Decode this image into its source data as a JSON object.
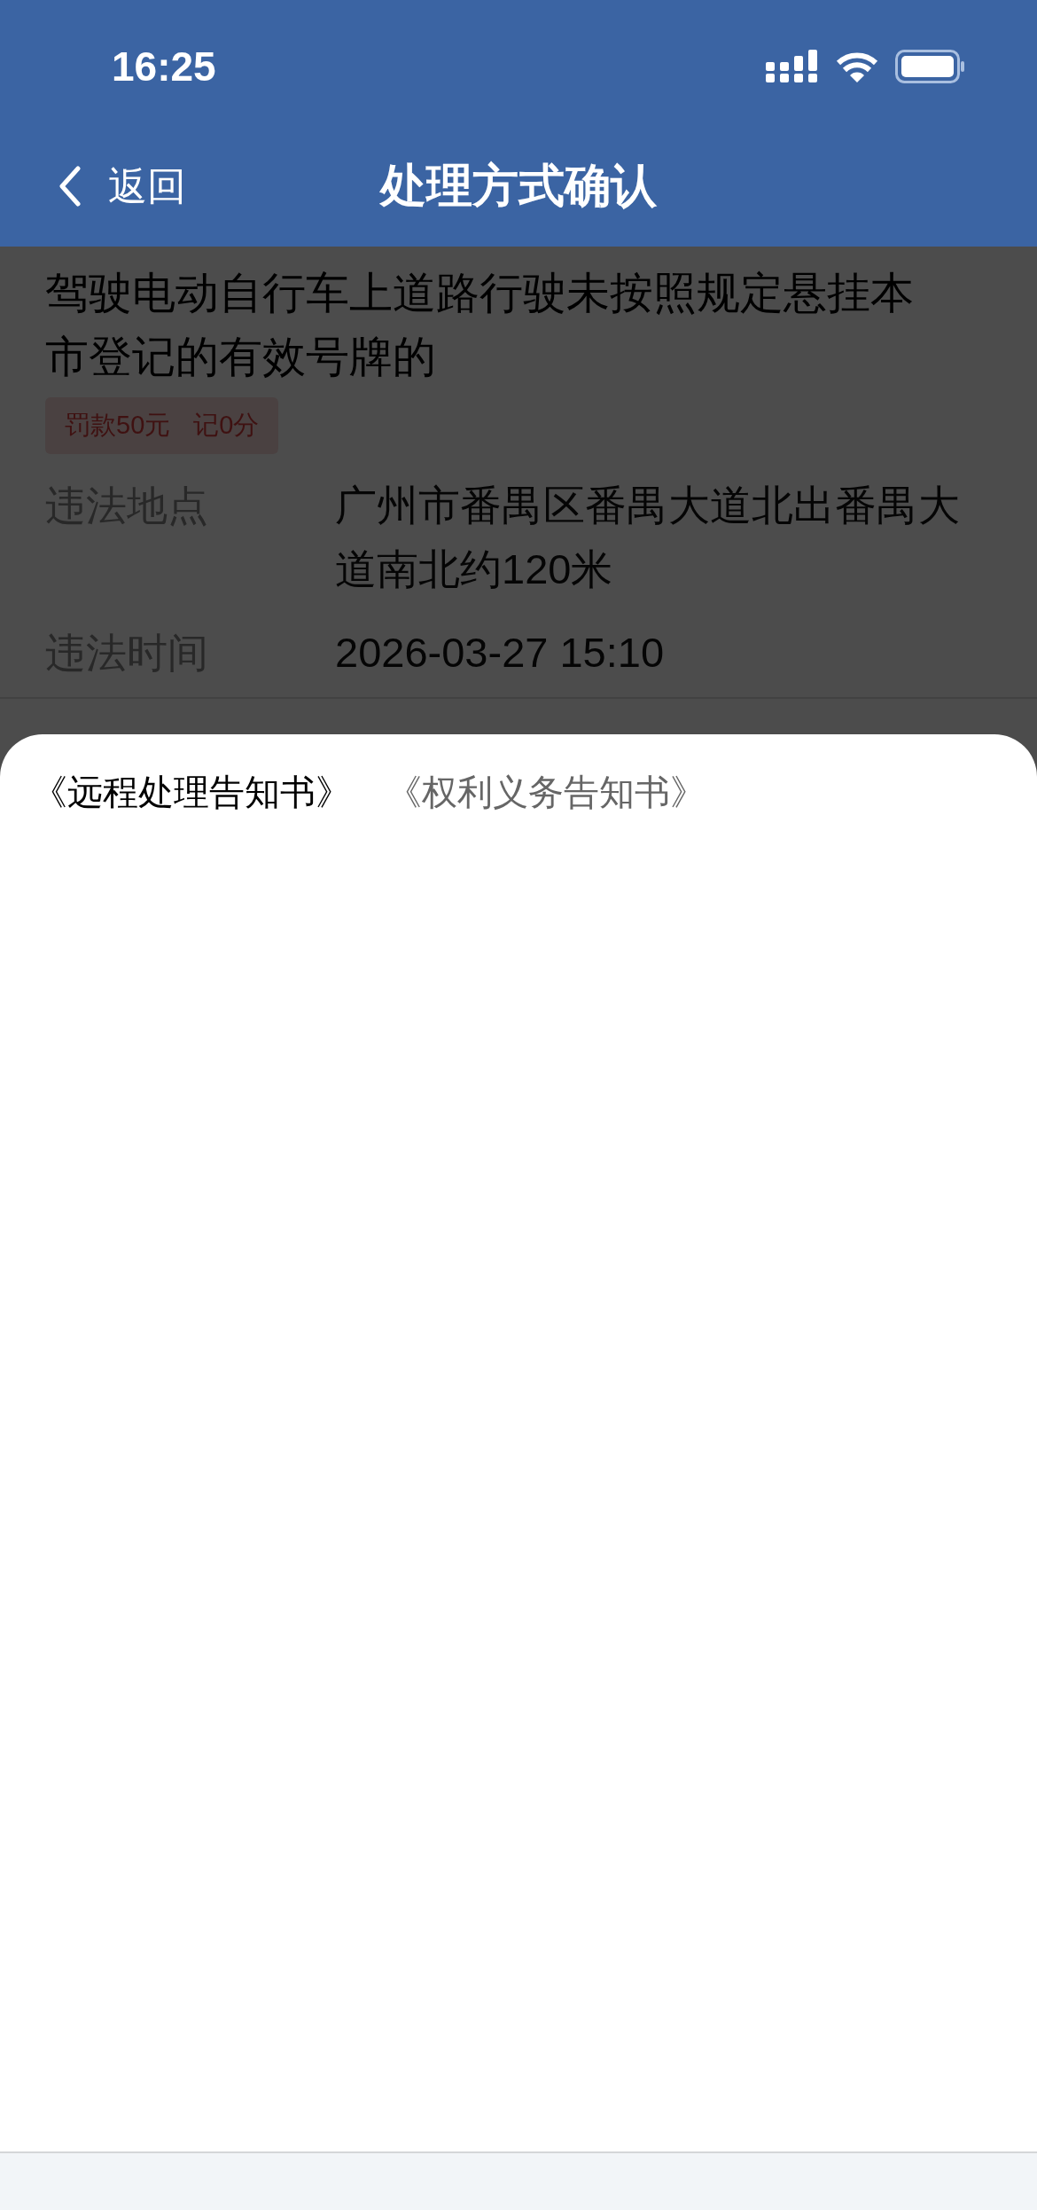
{
  "status_bar": {
    "time": "16:25"
  },
  "nav": {
    "back": "返回",
    "title": "处理方式确认"
  },
  "violation": {
    "title": "驾驶电动自行车上道路行驶未按照规定悬挂本市登记的有效号牌的",
    "tags": [
      "罚款50元",
      "记0分"
    ],
    "fields": [
      {
        "label": "违法地点",
        "value": "广州市番禺区番禺大道北出番禺大道南北约120米"
      },
      {
        "label": "违法时间",
        "value": "2026-03-27 15:10"
      }
    ]
  },
  "sheet": {
    "tabs": [
      {
        "label": "《远程处理告知书》",
        "selected": true
      },
      {
        "label": "《权利义务告知书》",
        "selected": false
      }
    ]
  }
}
